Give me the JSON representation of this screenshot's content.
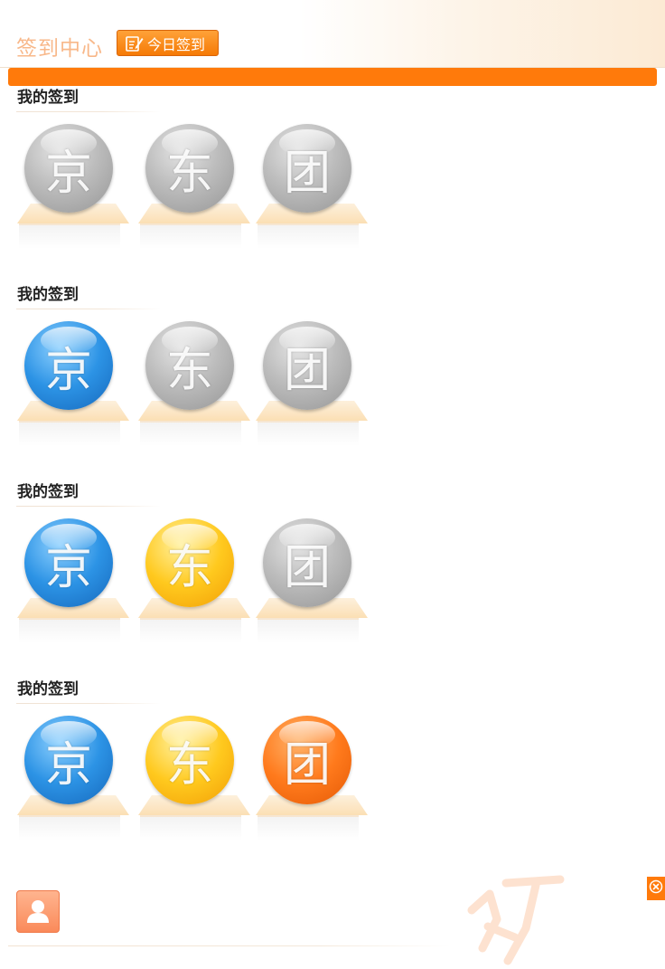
{
  "header": {
    "title": "签到中心",
    "checkin_button_label": "今日签到"
  },
  "sections": [
    {
      "title": "我的签到",
      "medals": [
        {
          "glyph": "京",
          "state": "gray"
        },
        {
          "glyph": "东",
          "state": "gray"
        },
        {
          "glyph": "团",
          "state": "gray"
        }
      ]
    },
    {
      "title": "我的签到",
      "medals": [
        {
          "glyph": "京",
          "state": "blue"
        },
        {
          "glyph": "东",
          "state": "gray"
        },
        {
          "glyph": "团",
          "state": "gray"
        }
      ]
    },
    {
      "title": "我的签到",
      "medals": [
        {
          "glyph": "京",
          "state": "blue"
        },
        {
          "glyph": "东",
          "state": "yellow"
        },
        {
          "glyph": "团",
          "state": "gray"
        }
      ]
    },
    {
      "title": "我的签到",
      "medals": [
        {
          "glyph": "京",
          "state": "blue"
        },
        {
          "glyph": "东",
          "state": "yellow"
        },
        {
          "glyph": "团",
          "state": "orange"
        }
      ]
    }
  ],
  "colors": {
    "accent": "#ff7a0b",
    "title_light": "#f8b88a",
    "avatar": "#fa8a5a"
  },
  "icons": {
    "checkin": "pen-edit-icon",
    "avatar": "user-icon",
    "close": "close-icon",
    "watermark": "logo-watermark-icon"
  }
}
